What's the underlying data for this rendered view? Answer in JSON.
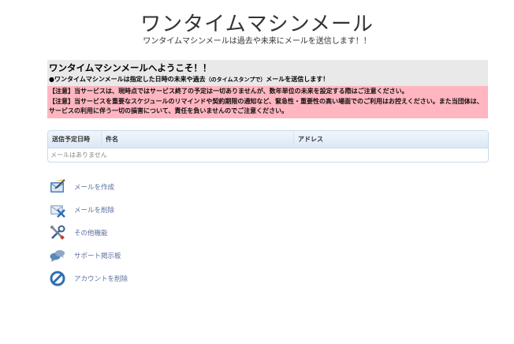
{
  "header": {
    "title": "ワンタイムマシンメール",
    "subtitle": "ワンタイムマシンメールは過去や未来にメールを送信します！！"
  },
  "notice": {
    "welcome": "ワンタイムマシンメールへようこそ！！",
    "intro_part1": "●ワンタイムマシンメールは指定した日時の未来や過去",
    "intro_small": "（のタイムスタンプで）",
    "intro_part2": "メールを送信します！",
    "caution1": "【注意】当サービスは、現時点ではサービス終了の予定は一切ありませんが、数年単位の未来を設定する際はご注意ください。",
    "caution2": "【注意】当サービスを重要なスケジュールのリマインドや契約期限の通知など、緊急性・重要性の高い場面でのご利用はお控えください。また当団体は、サービスの利用に伴う一切の損害について、責任を負いませんのでご注意ください。"
  },
  "table": {
    "columns": [
      "送信予定日時",
      "件名",
      "アドレス"
    ],
    "empty_message": "メールはありません"
  },
  "menu": {
    "items": [
      {
        "label": "メールを作成",
        "icon": "compose-mail-icon"
      },
      {
        "label": "メールを削除",
        "icon": "delete-mail-icon"
      },
      {
        "label": "その他機能",
        "icon": "tools-icon"
      },
      {
        "label": "サポート掲示板",
        "icon": "chat-bubbles-icon"
      },
      {
        "label": "アカウントを削除",
        "icon": "prohibited-icon"
      }
    ]
  },
  "colors": {
    "notice_gray": "#e9e9e9",
    "notice_pink": "#ffb6c1",
    "table_header": "#dbe8f6",
    "menu_link": "#5a6fa0"
  }
}
